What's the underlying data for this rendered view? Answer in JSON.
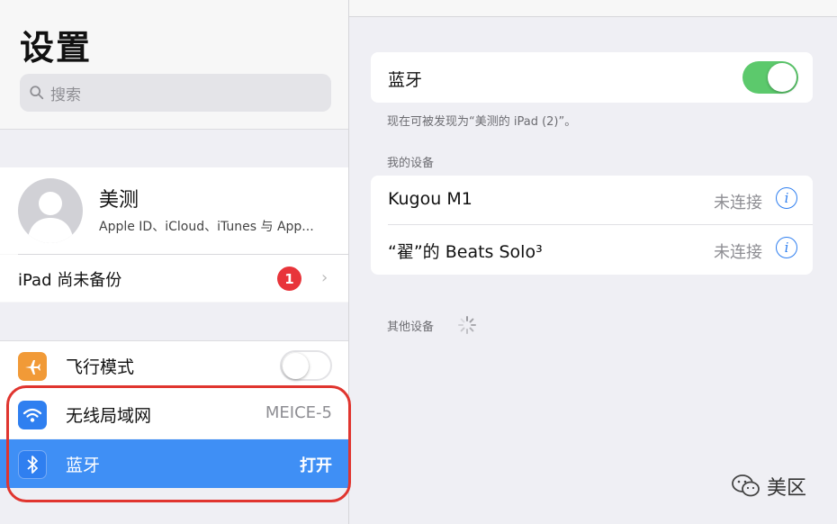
{
  "sidebar": {
    "title": "设置",
    "search_placeholder": "搜索",
    "profile": {
      "name": "美测",
      "subtitle": "Apple ID、iCloud、iTunes 与 App..."
    },
    "backup": {
      "label": "iPad 尚未备份",
      "badge": "1"
    },
    "rows": [
      {
        "label": "飞行模式",
        "icon": "airplane-icon",
        "color": "#f19a37",
        "toggle": "off"
      },
      {
        "label": "无线局域网",
        "value": "MEICE-5",
        "icon": "wifi-icon",
        "color": "#2f7ff0"
      },
      {
        "label": "蓝牙",
        "value": "打开",
        "icon": "bluetooth-icon",
        "color": "#2f7ff0",
        "selected": true
      }
    ]
  },
  "detail": {
    "bluetooth": {
      "label": "蓝牙",
      "toggle": "on"
    },
    "discoverable_note": "现在可被发现为“美测的 iPad (2)”。",
    "my_devices_header": "我的设备",
    "devices": [
      {
        "name": "Kugou M1",
        "status": "未连接"
      },
      {
        "name": "“翟”的 Beats Solo³",
        "status": "未连接"
      }
    ],
    "other_devices_header": "其他设备"
  },
  "watermark": "美区",
  "colors": {
    "accent": "#3f8ff5",
    "toggle_on": "#5cc96c",
    "badge": "#e8343a",
    "highlight": "#e0352f"
  }
}
